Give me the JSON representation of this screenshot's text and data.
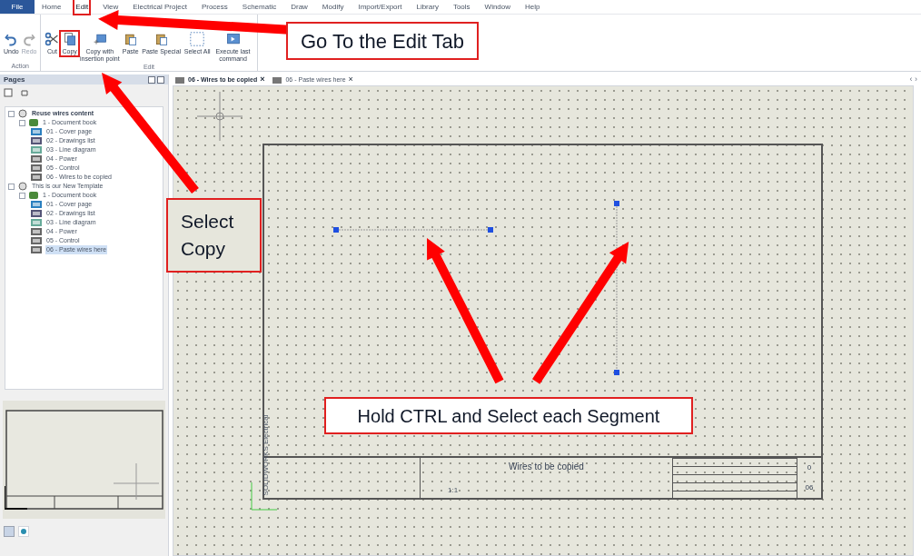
{
  "menu": [
    {
      "label": "File",
      "kind": "file",
      "selected": false
    },
    {
      "label": "Home",
      "kind": "tab",
      "selected": false
    },
    {
      "label": "Edit",
      "kind": "tab",
      "selected": true
    },
    {
      "label": "View",
      "kind": "tab",
      "selected": false
    },
    {
      "label": "Electrical Project",
      "kind": "tab",
      "selected": false
    },
    {
      "label": "Process",
      "kind": "tab",
      "selected": false
    },
    {
      "label": "Schematic",
      "kind": "tab",
      "selected": false
    },
    {
      "label": "Draw",
      "kind": "tab",
      "selected": false
    },
    {
      "label": "Modify",
      "kind": "tab",
      "selected": false
    },
    {
      "label": "Import/Export",
      "kind": "tab",
      "selected": false
    },
    {
      "label": "Library",
      "kind": "tab",
      "selected": false
    },
    {
      "label": "Tools",
      "kind": "tab",
      "selected": false
    },
    {
      "label": "Window",
      "kind": "tab",
      "selected": false
    },
    {
      "label": "Help",
      "kind": "tab",
      "selected": false
    }
  ],
  "ribbon": [
    {
      "label": "Action",
      "buttons": [
        {
          "label": "Undo",
          "kind": "undo",
          "disabled": false,
          "highlighted": false
        },
        {
          "label": "Redo",
          "kind": "redo",
          "disabled": true,
          "highlighted": false
        }
      ]
    },
    {
      "label": "Edit",
      "buttons": [
        {
          "label": "Cut",
          "kind": "cut",
          "disabled": false,
          "highlighted": false
        },
        {
          "label": "Copy",
          "kind": "copy",
          "disabled": false,
          "highlighted": true
        },
        {
          "label": "Copy with insertion point",
          "kind": "copypoint",
          "disabled": false,
          "highlighted": false
        },
        {
          "label": "Paste",
          "kind": "paste",
          "disabled": false,
          "highlighted": false
        },
        {
          "label": "Paste Special",
          "kind": "paste",
          "disabled": false,
          "highlighted": false
        },
        {
          "label": "Select All",
          "kind": "select",
          "disabled": false,
          "highlighted": false
        },
        {
          "label": "Execute last command",
          "kind": "execute",
          "disabled": false,
          "highlighted": false
        }
      ]
    }
  ],
  "pages_panel": {
    "title": "Pages",
    "tree": [
      {
        "label": "Reuse wires content",
        "kind": "project",
        "expanded": true,
        "bold": true,
        "children": [
          {
            "label": "1 - Document book",
            "kind": "book",
            "expanded": true,
            "children": [
              {
                "label": "01 - Cover page",
                "kind": "cover",
                "open": false,
                "selected": false
              },
              {
                "label": "02 - Drawings list",
                "kind": "list",
                "open": false,
                "selected": false
              },
              {
                "label": "03 - Line diagram",
                "kind": "diagram",
                "open": false,
                "selected": false
              },
              {
                "label": "04 - Power",
                "kind": "schematic",
                "open": false,
                "selected": false
              },
              {
                "label": "05 - Control",
                "kind": "schematic",
                "open": false,
                "selected": false
              },
              {
                "label": "06 - Wires to be copied",
                "kind": "schematic",
                "open": true,
                "selected": false
              }
            ]
          }
        ]
      },
      {
        "label": "This is our New Template",
        "kind": "project",
        "expanded": true,
        "bold": false,
        "children": [
          {
            "label": "1 - Document book",
            "kind": "book",
            "expanded": true,
            "children": [
              {
                "label": "01 - Cover page",
                "kind": "cover",
                "open": false,
                "selected": false
              },
              {
                "label": "02 - Drawings list",
                "kind": "list",
                "open": false,
                "selected": false
              },
              {
                "label": "03 - Line diagram",
                "kind": "diagram",
                "open": false,
                "selected": false
              },
              {
                "label": "04 - Power",
                "kind": "schematic",
                "open": false,
                "selected": false
              },
              {
                "label": "05 - Control",
                "kind": "schematic",
                "open": false,
                "selected": false
              },
              {
                "label": "06 - Paste wires here",
                "kind": "schematic",
                "open": false,
                "selected": true
              }
            ]
          }
        ]
      }
    ]
  },
  "document_tabs": [
    {
      "label": "06 - Wires to be copied",
      "close": "×",
      "selected": true
    },
    {
      "label": "06 - Paste wires here",
      "close": "×",
      "selected": false
    }
  ],
  "tab_scroll": "‹ ›",
  "drawing": {
    "title": "Wires to be copied",
    "scale": "1:1",
    "revision": "0",
    "sheet": "06",
    "side_label": "SOLIDWORKS Electrical"
  },
  "annotations": [
    {
      "text": "Go To the Edit Tab"
    },
    {
      "text": "Select Copy"
    },
    {
      "text": "Hold CTRL and Select each Segment"
    }
  ]
}
